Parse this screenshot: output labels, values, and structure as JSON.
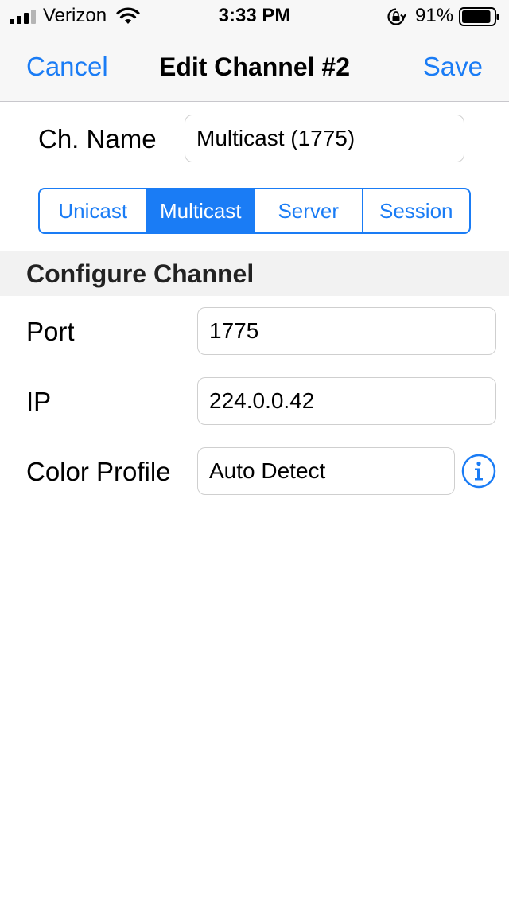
{
  "status_bar": {
    "carrier": "Verizon",
    "time": "3:33 PM",
    "battery_percent": "91%",
    "battery_level": 0.91,
    "icons": [
      "signal-bars-icon",
      "wifi-icon",
      "orientation-lock-icon",
      "battery-icon"
    ]
  },
  "nav": {
    "cancel_label": "Cancel",
    "title": "Edit Channel #2",
    "save_label": "Save"
  },
  "channel_name": {
    "label": "Ch. Name",
    "value": "Multicast (1775)"
  },
  "mode_selector": {
    "options": [
      "Unicast",
      "Multicast",
      "Server",
      "Session"
    ],
    "selected": "Multicast"
  },
  "configure": {
    "section_title": "Configure Channel",
    "port": {
      "label": "Port",
      "value": "1775"
    },
    "ip": {
      "label": "IP",
      "value": "224.0.0.42"
    },
    "color_profile": {
      "label": "Color Profile",
      "value": "Auto Detect"
    }
  },
  "colors": {
    "accent": "#1a7cf5",
    "nav_background": "#f7f7f7",
    "section_background": "#f2f2f2",
    "input_border": "#cfcfcf"
  }
}
